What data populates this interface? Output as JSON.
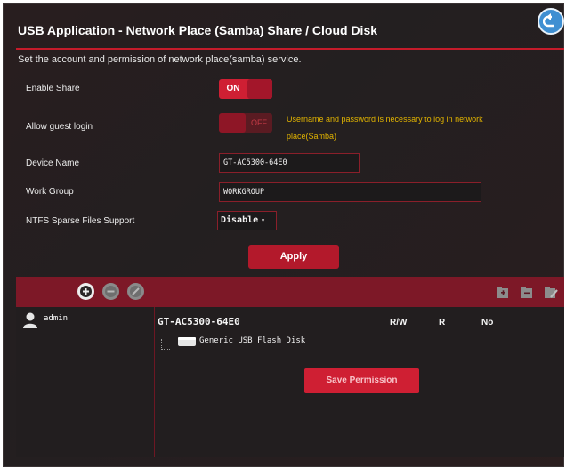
{
  "header": {
    "title": "USB Application - Network Place (Samba) Share / Cloud Disk",
    "subtitle": "Set the account and permission of network place(samba) service."
  },
  "settings": {
    "enable_share": {
      "label": "Enable Share",
      "state": "ON"
    },
    "allow_guest": {
      "label": "Allow guest login",
      "state": "OFF",
      "note": "Username and password is necessary to log in network place(Samba)"
    },
    "device_name": {
      "label": "Device Name",
      "value": "GT-AC5300-64E0"
    },
    "work_group": {
      "label": "Work Group",
      "value": "WORKGROUP"
    },
    "ntfs_sparse": {
      "label": "NTFS Sparse Files Support",
      "value": "Disable",
      "arrow": "▾"
    },
    "apply_label": "Apply"
  },
  "toolbar": {
    "left_icons": [
      "add-circle-icon",
      "remove-circle-icon",
      "edit-circle-icon"
    ],
    "right_icons": [
      "new-folder-icon",
      "delete-folder-icon",
      "edit-folder-icon"
    ]
  },
  "accounts": [
    {
      "name": "admin"
    }
  ],
  "permissions": {
    "device": "GT-AC5300-64E0",
    "columns": [
      "R/W",
      "R",
      "No"
    ],
    "disk": "Generic USB Flash Disk",
    "save_label": "Save Permission"
  },
  "colors": {
    "background": "#231f20",
    "accent_red": "#cf1f33",
    "bar_red": "#7d1827",
    "note_yellow": "#e2b400",
    "back_blue": "#3f8fd2"
  }
}
